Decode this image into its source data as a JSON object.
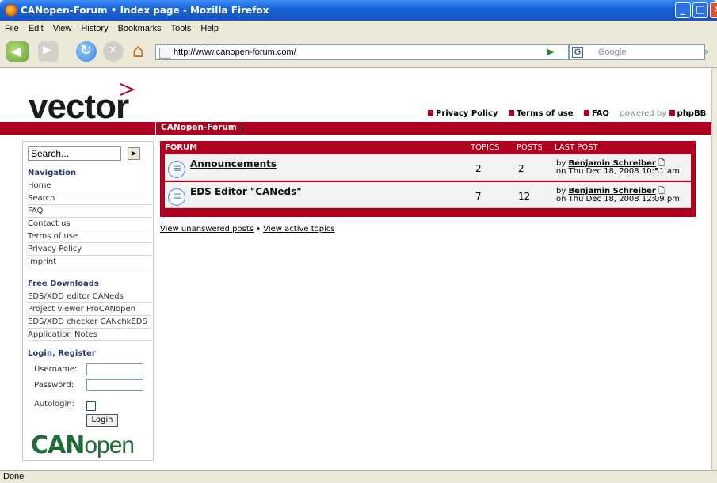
{
  "window": {
    "title": "CANopen-Forum • Index page - Mozilla Firefox"
  },
  "menu": [
    "File",
    "Edit",
    "View",
    "History",
    "Bookmarks",
    "Tools",
    "Help"
  ],
  "browser": {
    "url": "http://www.canopen-forum.com/",
    "search_placeholder": "Google",
    "status": "Done"
  },
  "header": {
    "logo": "vector",
    "links": [
      "Privacy Policy",
      "Terms of use",
      "FAQ"
    ],
    "powered_by": "powered by",
    "phpbb": "phpBB",
    "breadcrumb": "CANopen-Forum"
  },
  "sidebar": {
    "search_value": "Search...",
    "navigation_title": "Navigation",
    "navigation": [
      "Home",
      "Search",
      "FAQ",
      "Contact us",
      "Terms of use",
      "Privacy Policy",
      "Imprint"
    ],
    "downloads_title": "Free Downloads",
    "downloads": [
      "EDS/XDD editor CANeds",
      "Project viewer ProCANopen",
      "EDS/XDD checker CANchkEDS",
      "Application Notes"
    ],
    "login_title": "Login, Register",
    "username_label": "Username:",
    "password_label": "Password:",
    "autologin_label": "Autologin:",
    "login_button": "Login",
    "canopen_logo_bold": "CAN",
    "canopen_logo_rest": "open"
  },
  "forum": {
    "headers": {
      "forum": "FORUM",
      "topics": "TOPICS",
      "posts": "POSTS",
      "last_post": "LAST POST"
    },
    "rows": [
      {
        "title": "Announcements",
        "topics": "2",
        "posts": "2",
        "by_prefix": "by",
        "author": "Benjamin Schreiber",
        "date": "on Thu Dec 18, 2008 10:51 am"
      },
      {
        "title": "EDS Editor \"CANeds\"",
        "topics": "7",
        "posts": "12",
        "by_prefix": "by",
        "author": "Benjamin Schreiber",
        "date": "on Thu Dec 18, 2008 12:09 pm"
      }
    ],
    "links": {
      "unanswered": "View unanswered posts",
      "sep": "•",
      "active": "View active topics"
    }
  }
}
